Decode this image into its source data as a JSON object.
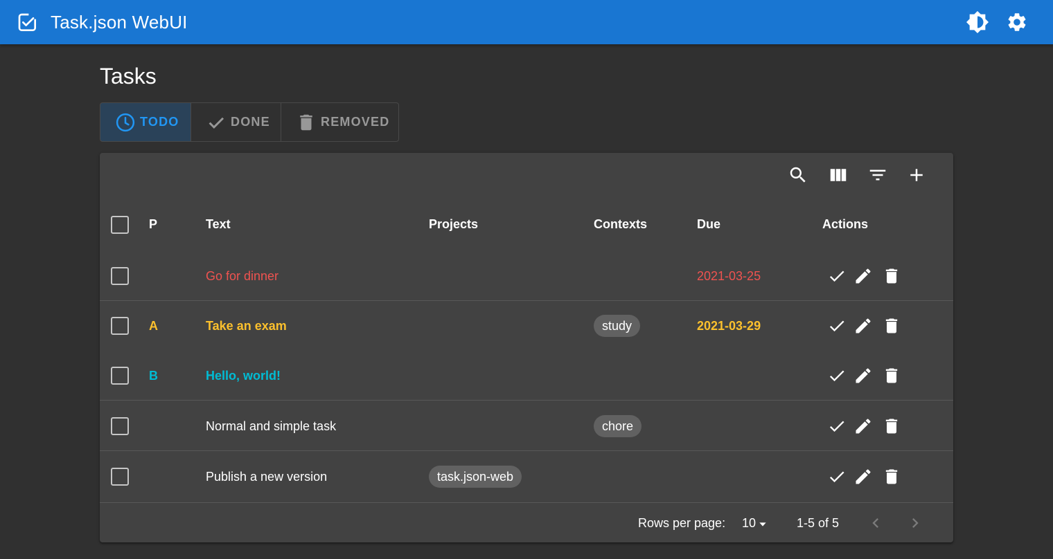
{
  "app": {
    "title": "Task.json WebUI",
    "logo_icon": "task-check-icon",
    "theme_icon": "brightness-icon",
    "settings_icon": "gear-icon",
    "bar_color": "#1976d2"
  },
  "page": {
    "title": "Tasks",
    "tabs": [
      {
        "label": "TODO",
        "icon": "clock-icon",
        "active": true
      },
      {
        "label": "DONE",
        "icon": "check-icon",
        "active": false
      },
      {
        "label": "REMOVED",
        "icon": "trash-icon",
        "active": false
      }
    ]
  },
  "toolbar": {
    "icons": [
      "search-icon",
      "view-columns-icon",
      "filter-icon",
      "add-icon"
    ]
  },
  "table": {
    "columns": [
      "P",
      "Text",
      "Projects",
      "Contexts",
      "Due",
      "Actions"
    ],
    "rows": [
      {
        "priority": "",
        "text": "Go for dinner",
        "project": "",
        "context": "",
        "due": "2021-03-25",
        "color": "#ef5350"
      },
      {
        "priority": "A",
        "text": "Take an exam",
        "project": "",
        "context": "study",
        "due": "2021-03-29",
        "color": "#fbc02d"
      },
      {
        "priority": "B",
        "text": "Hello, world!",
        "project": "",
        "context": "",
        "due": "",
        "color": "#00bcd4"
      },
      {
        "priority": "",
        "text": "Normal and simple task",
        "project": "",
        "context": "chore",
        "due": "",
        "color": "#ffffff"
      },
      {
        "priority": "",
        "text": "Publish a new version",
        "project": "task.json-web",
        "context": "",
        "due": "",
        "color": "#ffffff"
      }
    ],
    "action_icons": [
      "check-icon",
      "pencil-icon",
      "trash-icon"
    ]
  },
  "footer": {
    "rows_per_page_label": "Rows per page:",
    "rows_per_page_value": "10",
    "page_info": "1-5 of 5"
  }
}
